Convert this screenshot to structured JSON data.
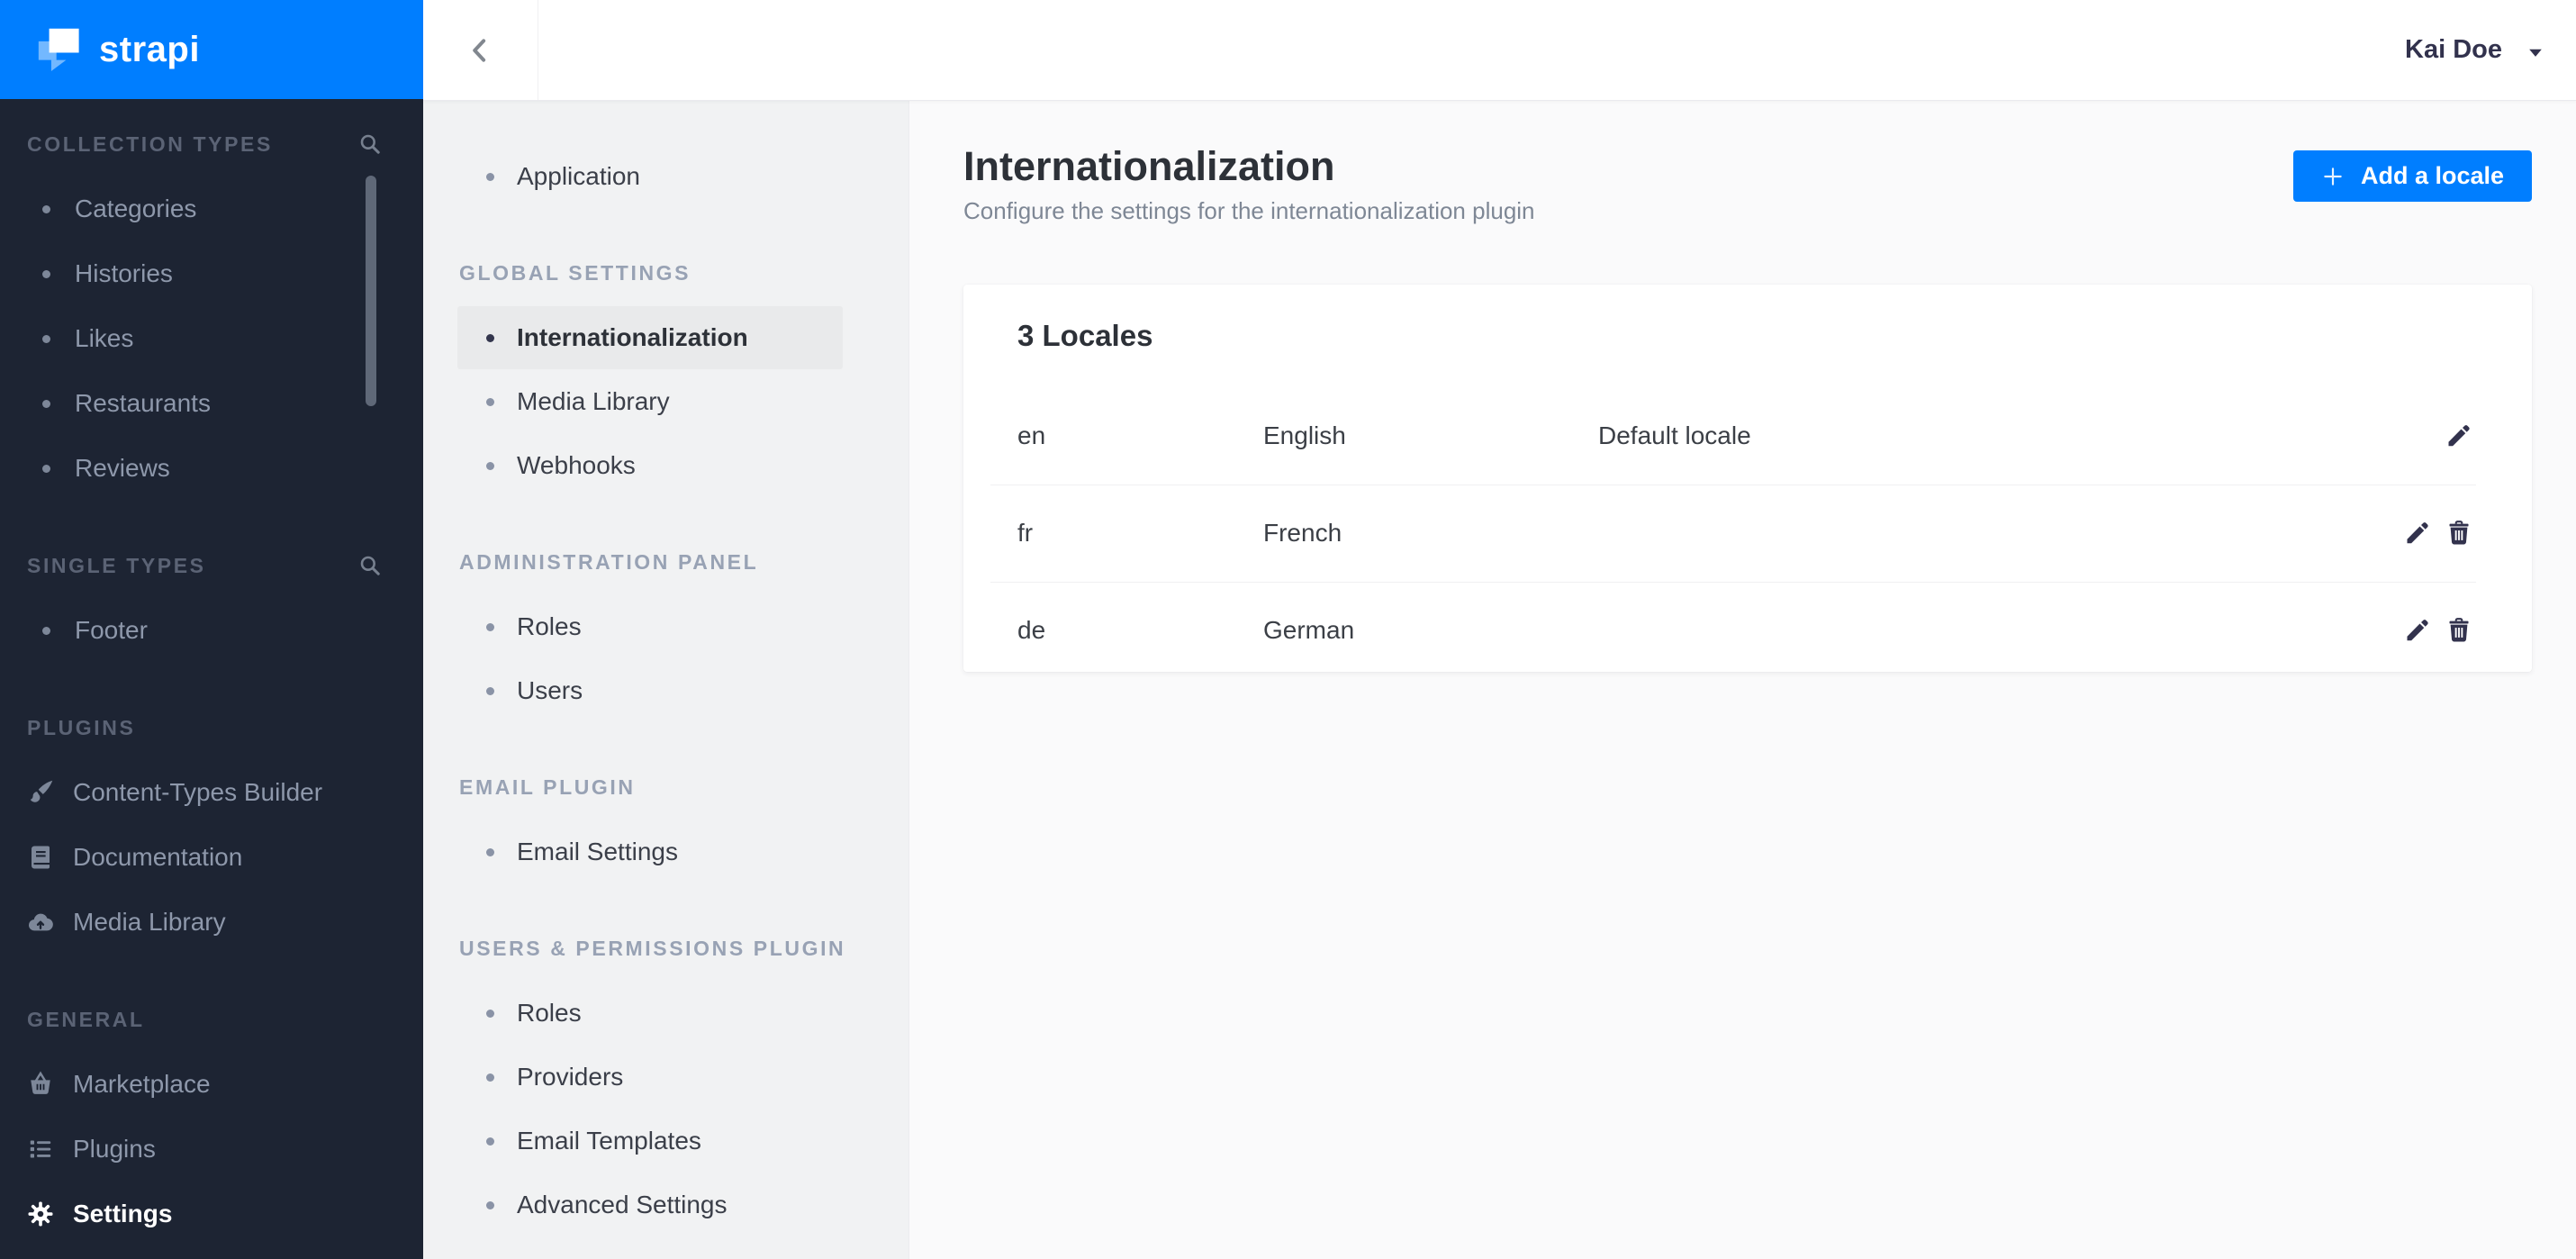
{
  "colors": {
    "primary_blue": "#007eff",
    "sidebar_bg": "#1d2433",
    "subnav_bg": "#f1f2f3",
    "content_bg": "#fafafb"
  },
  "brand": {
    "name": "strapi"
  },
  "topbar": {
    "user_name": "Kai Doe"
  },
  "sidebar": {
    "sections": [
      {
        "label": "COLLECTION TYPES",
        "icon": "search-icon",
        "items": [
          {
            "label": "Categories"
          },
          {
            "label": "Histories"
          },
          {
            "label": "Likes"
          },
          {
            "label": "Restaurants"
          },
          {
            "label": "Reviews"
          }
        ]
      },
      {
        "label": "SINGLE TYPES",
        "icon": "search-icon",
        "items": [
          {
            "label": "Footer"
          }
        ]
      },
      {
        "label": "PLUGINS",
        "items": [
          {
            "label": "Content-Types Builder",
            "icon": "paintbrush-icon"
          },
          {
            "label": "Documentation",
            "icon": "book-icon"
          },
          {
            "label": "Media Library",
            "icon": "cloud-upload-icon"
          }
        ]
      },
      {
        "label": "GENERAL",
        "items": [
          {
            "label": "Marketplace",
            "icon": "basket-icon"
          },
          {
            "label": "Plugins",
            "icon": "list-icon"
          },
          {
            "label": "Settings",
            "icon": "gear-icon",
            "active": true
          }
        ]
      }
    ]
  },
  "settings_nav": {
    "top_items": [
      {
        "label": "Application"
      }
    ],
    "sections": [
      {
        "label": "GLOBAL SETTINGS",
        "items": [
          {
            "label": "Internationalization",
            "active": true
          },
          {
            "label": "Media Library"
          },
          {
            "label": "Webhooks"
          }
        ]
      },
      {
        "label": "ADMINISTRATION PANEL",
        "items": [
          {
            "label": "Roles"
          },
          {
            "label": "Users"
          }
        ]
      },
      {
        "label": "EMAIL PLUGIN",
        "items": [
          {
            "label": "Email Settings"
          }
        ]
      },
      {
        "label": "USERS & PERMISSIONS PLUGIN",
        "items": [
          {
            "label": "Roles"
          },
          {
            "label": "Providers"
          },
          {
            "label": "Email Templates"
          },
          {
            "label": "Advanced Settings"
          }
        ]
      }
    ]
  },
  "main": {
    "title": "Internationalization",
    "subtitle": "Configure the settings for the internationalization plugin",
    "add_button_label": "Add a locale",
    "card": {
      "title": "3 Locales",
      "rows": [
        {
          "code": "en",
          "name": "English",
          "badge": "Default locale"
        },
        {
          "code": "fr",
          "name": "French",
          "badge": ""
        },
        {
          "code": "de",
          "name": "German",
          "badge": ""
        }
      ]
    }
  }
}
